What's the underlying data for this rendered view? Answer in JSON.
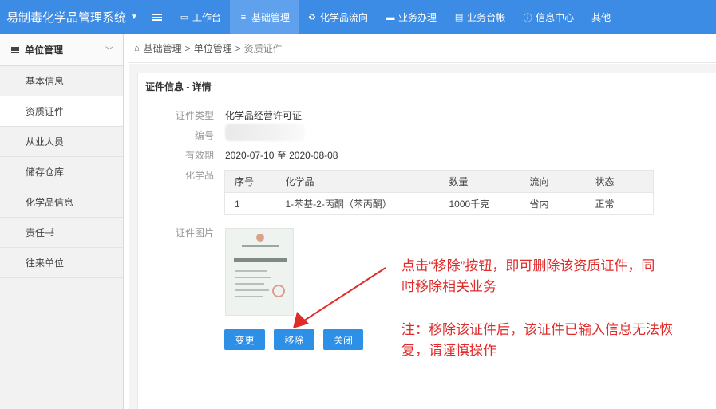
{
  "app": {
    "title": "易制毒化学品管理系统"
  },
  "nav": [
    {
      "icon": "menu-icon",
      "label": ""
    },
    {
      "icon": "desktop-icon",
      "label": "工作台"
    },
    {
      "icon": "list-icon",
      "label": "基础管理",
      "active": true
    },
    {
      "icon": "recycle-icon",
      "label": "化学品流向"
    },
    {
      "icon": "briefcase-icon",
      "label": "业务办理"
    },
    {
      "icon": "ledger-icon",
      "label": "业务台帐"
    },
    {
      "icon": "info-circle-icon",
      "label": "信息中心"
    },
    {
      "icon": "",
      "label": "其他"
    }
  ],
  "sidebar": {
    "header": "单位管理",
    "items": [
      {
        "label": "基本信息"
      },
      {
        "label": "资质证件",
        "active": true
      },
      {
        "label": "从业人员"
      },
      {
        "label": "储存仓库"
      },
      {
        "label": "化学品信息"
      },
      {
        "label": "责任书"
      },
      {
        "label": "往来单位"
      }
    ]
  },
  "breadcrumb": {
    "a": "基础管理",
    "sep": ">",
    "b": "单位管理",
    "c": "资质证件"
  },
  "panel": {
    "title": "证件信息 - 详情",
    "fields": {
      "type_label": "证件类型",
      "type_value": "化学品经营许可证",
      "number_label": "编号",
      "validity_label": "有效期",
      "validity_from": "2020-07-10",
      "validity_to_word": "至",
      "validity_to": "2020-08-08",
      "chemicals_label": "化学品",
      "image_label": "证件图片"
    },
    "table": {
      "headers": [
        "序号",
        "化学品",
        "数量",
        "流向",
        "状态"
      ],
      "rows": [
        [
          "1",
          "1-苯基-2-丙酮（苯丙酮）",
          "1000千克",
          "省内",
          "正常"
        ]
      ]
    },
    "buttons": {
      "change": "变更",
      "remove": "移除",
      "close": "关闭"
    }
  },
  "annotation": {
    "line1": "点击“移除”按钮，即可删除该资质证件，同",
    "line2": "时移除相关业务",
    "line3": "注：移除该证件后，该证件已输入信息无法恢",
    "line4": "复，请谨慎操作",
    "color": "#e02b2b"
  },
  "colors": {
    "topbar": "#3c8be4",
    "active_nav": "#5fa1ec",
    "button": "#2e8fe6"
  }
}
